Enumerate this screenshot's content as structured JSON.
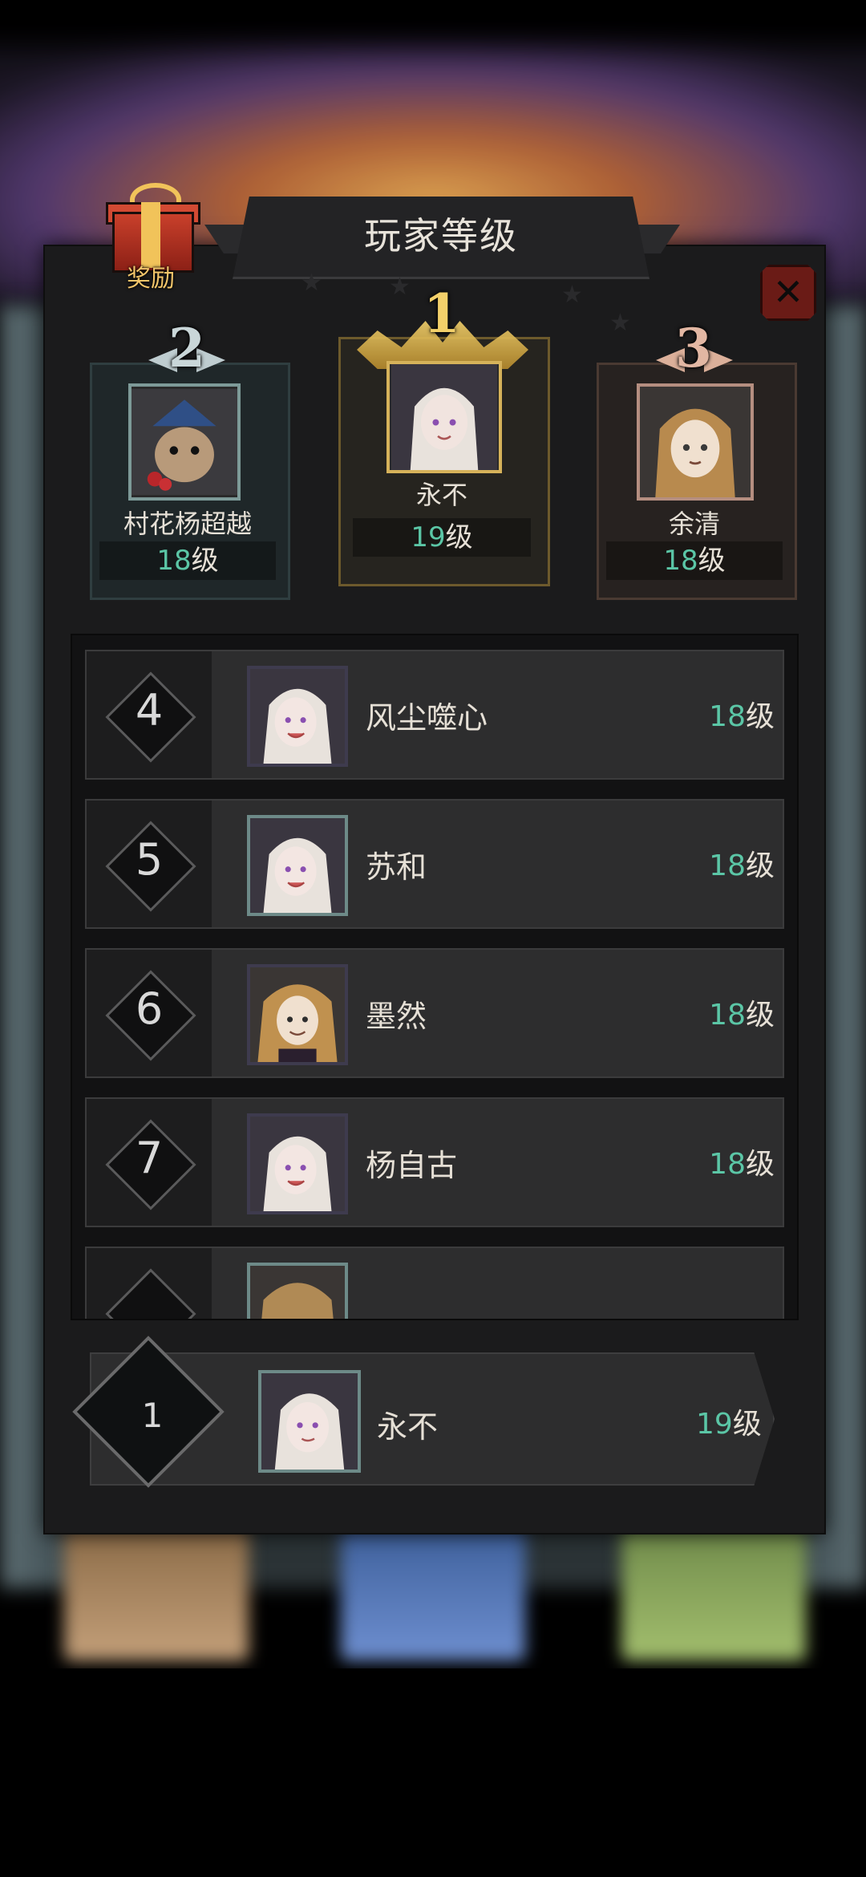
{
  "title": "玩家等级",
  "reward_label": "奖励",
  "close_icon": "close-icon",
  "podium": [
    {
      "rank": "1",
      "name": "永不",
      "level_num": "19",
      "level_unit": "级"
    },
    {
      "rank": "2",
      "name": "村花杨超越",
      "level_num": "18",
      "level_unit": "级"
    },
    {
      "rank": "3",
      "name": "余清",
      "level_num": "18",
      "level_unit": "级"
    }
  ],
  "list": [
    {
      "rank": "4",
      "name": "风尘噬心",
      "level_num": "18",
      "level_unit": "级"
    },
    {
      "rank": "5",
      "name": "苏和",
      "level_num": "18",
      "level_unit": "级"
    },
    {
      "rank": "6",
      "name": "墨然",
      "level_num": "18",
      "level_unit": "级"
    },
    {
      "rank": "7",
      "name": "杨自古",
      "level_num": "18",
      "level_unit": "级"
    }
  ],
  "self": {
    "rank": "1",
    "name": "永不",
    "level_num": "19",
    "level_unit": "级"
  },
  "colors": {
    "level_number": "#5bc6a6",
    "panel": "#1b1b1c",
    "gold": "#d6b25a",
    "close": "#6a1b16"
  }
}
